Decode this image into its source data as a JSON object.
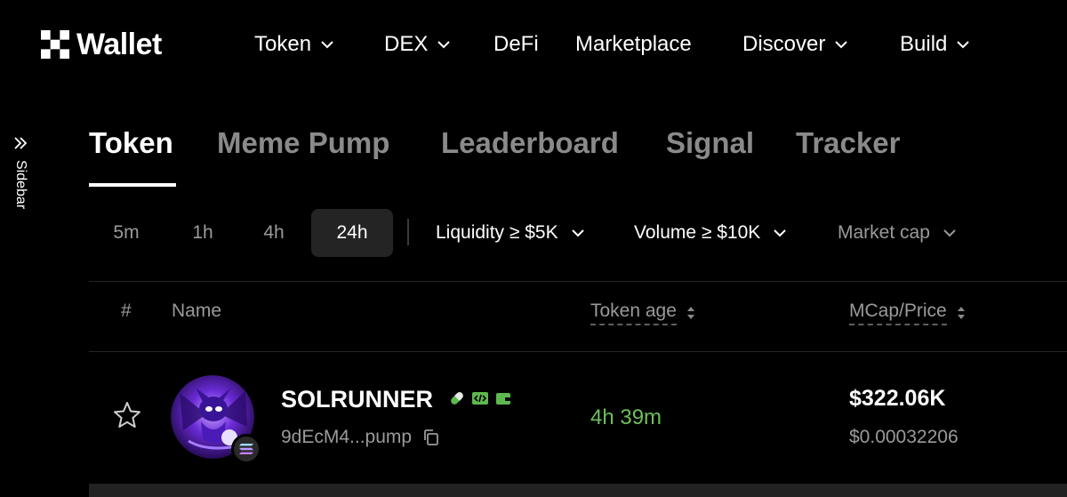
{
  "brand": {
    "name": "Wallet"
  },
  "nav": {
    "items": [
      {
        "label": "Token",
        "has_dropdown": true
      },
      {
        "label": "DEX",
        "has_dropdown": true
      },
      {
        "label": "DeFi",
        "has_dropdown": false
      },
      {
        "label": "Marketplace",
        "has_dropdown": false
      },
      {
        "label": "Discover",
        "has_dropdown": true
      },
      {
        "label": "Build",
        "has_dropdown": true
      }
    ]
  },
  "sidebar": {
    "label": "Sidebar",
    "icon": "double-chevron-right-icon"
  },
  "tabs": [
    {
      "label": "Token",
      "active": true
    },
    {
      "label": "Meme Pump",
      "active": false
    },
    {
      "label": "Leaderboard",
      "active": false
    },
    {
      "label": "Signal",
      "active": false
    },
    {
      "label": "Tracker",
      "active": false
    }
  ],
  "timeframes": [
    {
      "label": "5m",
      "active": false
    },
    {
      "label": "1h",
      "active": false
    },
    {
      "label": "4h",
      "active": false
    },
    {
      "label": "24h",
      "active": true
    }
  ],
  "filters": {
    "liquidity": "Liquidity ≥ $5K",
    "volume": "Volume ≥ $10K",
    "market_cap": "Market cap"
  },
  "table": {
    "headers": {
      "rank": "#",
      "name": "Name",
      "token_age": "Token age",
      "mcap_price": "MCap/Price"
    },
    "rows": [
      {
        "name": "SOLRUNNER",
        "address": "9dEcM4...pump",
        "age": "4h 39m",
        "mcap": "$322.06K",
        "price": "$0.00032206",
        "chain_icon": "solana-icon",
        "badge_icons": [
          "pill-icon",
          "code-icon",
          "wallet-icon"
        ]
      }
    ]
  },
  "colors": {
    "background": "#000000",
    "text_primary": "#ffffff",
    "text_muted": "#9a9a9a",
    "positive": "#6cc05a",
    "badge_green": "#5fb84f",
    "active_chip": "#242424"
  }
}
